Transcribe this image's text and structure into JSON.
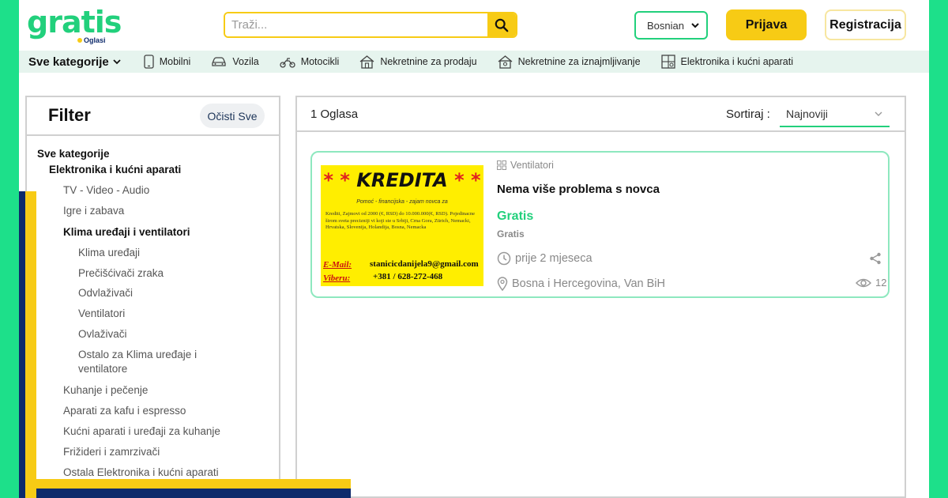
{
  "header": {
    "logo_text": "gratis",
    "logo_sub": "Oglasi",
    "search_placeholder": "Traži...",
    "language": "Bosnian",
    "login_label": "Prijava",
    "register_label": "Registracija"
  },
  "nav": {
    "all_label": "Sve kategorije",
    "items": [
      {
        "label": "Mobilni",
        "icon": "phone-icon"
      },
      {
        "label": "Vozila",
        "icon": "car-icon"
      },
      {
        "label": "Motocikli",
        "icon": "motorcycle-icon"
      },
      {
        "label": "Nekretnine za prodaju",
        "icon": "house-icon"
      },
      {
        "label": "Nekretnine za iznajmljivanje",
        "icon": "house-rent-icon"
      },
      {
        "label": "Elektronika i kućni aparati",
        "icon": "appliance-icon"
      }
    ]
  },
  "filter": {
    "title": "Filter",
    "clear_label": "Očisti Sve",
    "all_categories": "Sve kategorije",
    "category": "Elektronika i kućni aparati",
    "subcategories": [
      "TV - Video - Audio",
      "Igre i zabava",
      "Klima uređaji i ventilatori",
      "Kuhanje i pečenje",
      "Aparati za kafu i espresso",
      "Kućni aparati i uređaji za kuhanje",
      "Frižideri i zamrzivači",
      "Ostala Elektronika i kućni aparati"
    ],
    "subsubcategories": [
      "Klima uređaji",
      "Prečišćivači zraka",
      "Odvlaživači",
      "Ventilatori",
      "Ovlaživači",
      "Ostalo za Klima uređaje i ventilatore"
    ]
  },
  "results": {
    "count_label": "1 Oglasa",
    "sort_label": "Sortiraj :",
    "sort_value": "Najnoviji",
    "listing": {
      "category": "Ventilatori",
      "title": "Nema više problema s novca",
      "price": "Gratis",
      "price_sub": "Gratis",
      "time": "prije 2 mjeseca",
      "location": "Bosna i Hercegovina, Van BiH",
      "views": "12",
      "image": {
        "headline": "KREDITA",
        "stars": "* *",
        "tagline": "Pomoć - financijska - zajam novca za",
        "body": "Krediti, Zajmovi od 2000 (€, RSD) do 10.000.000(€, RSD). Pojedinacne širom sveta precizniji vi koji ste u Srbiji, Crna Gora, Zürich, Nemacki, Hrvatska, Slovenija, Holandija, Bosna, Nemacka",
        "email_label": "E-Mail:",
        "email": "stanicicdanijela9@gmail.com",
        "viber_label": "Viberu:",
        "phone": "+381 / 628-272-468"
      }
    }
  },
  "colors": {
    "brand_green": "#22d07c",
    "brand_yellow": "#f7cb15",
    "brand_navy": "#0d2a6b"
  }
}
